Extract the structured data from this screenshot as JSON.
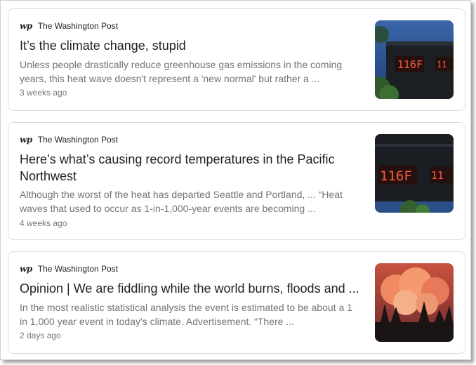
{
  "articles": [
    {
      "source": "The Washington Post",
      "logo_text": "wp",
      "title": "It’s the climate change, stupid",
      "snippet": "Unless people drastically reduce greenhouse gas emissions in the coming years, this heat wave doesn't represent a 'new normal' but rather a ...",
      "age": "3 weeks ago",
      "thumb_text": "116F"
    },
    {
      "source": "The Washington Post",
      "logo_text": "wp",
      "title": "Here’s what’s causing record temperatures in the Pacific Northwest",
      "snippet": "Although the worst of the heat has departed Seattle and Portland, ... “Heat waves that used to occur as 1-in-1,000-year events are becoming ...",
      "age": "4 weeks ago",
      "thumb_text": "116F"
    },
    {
      "source": "The Washington Post",
      "logo_text": "wp",
      "title": "Opinion | We are fiddling while the world burns, floods and ...",
      "snippet": "In the most realistic statistical analysis the event is estimated to be about a 1 in 1,000 year event in today's climate. Advertisement. “There ...",
      "age": "2 days ago"
    }
  ]
}
